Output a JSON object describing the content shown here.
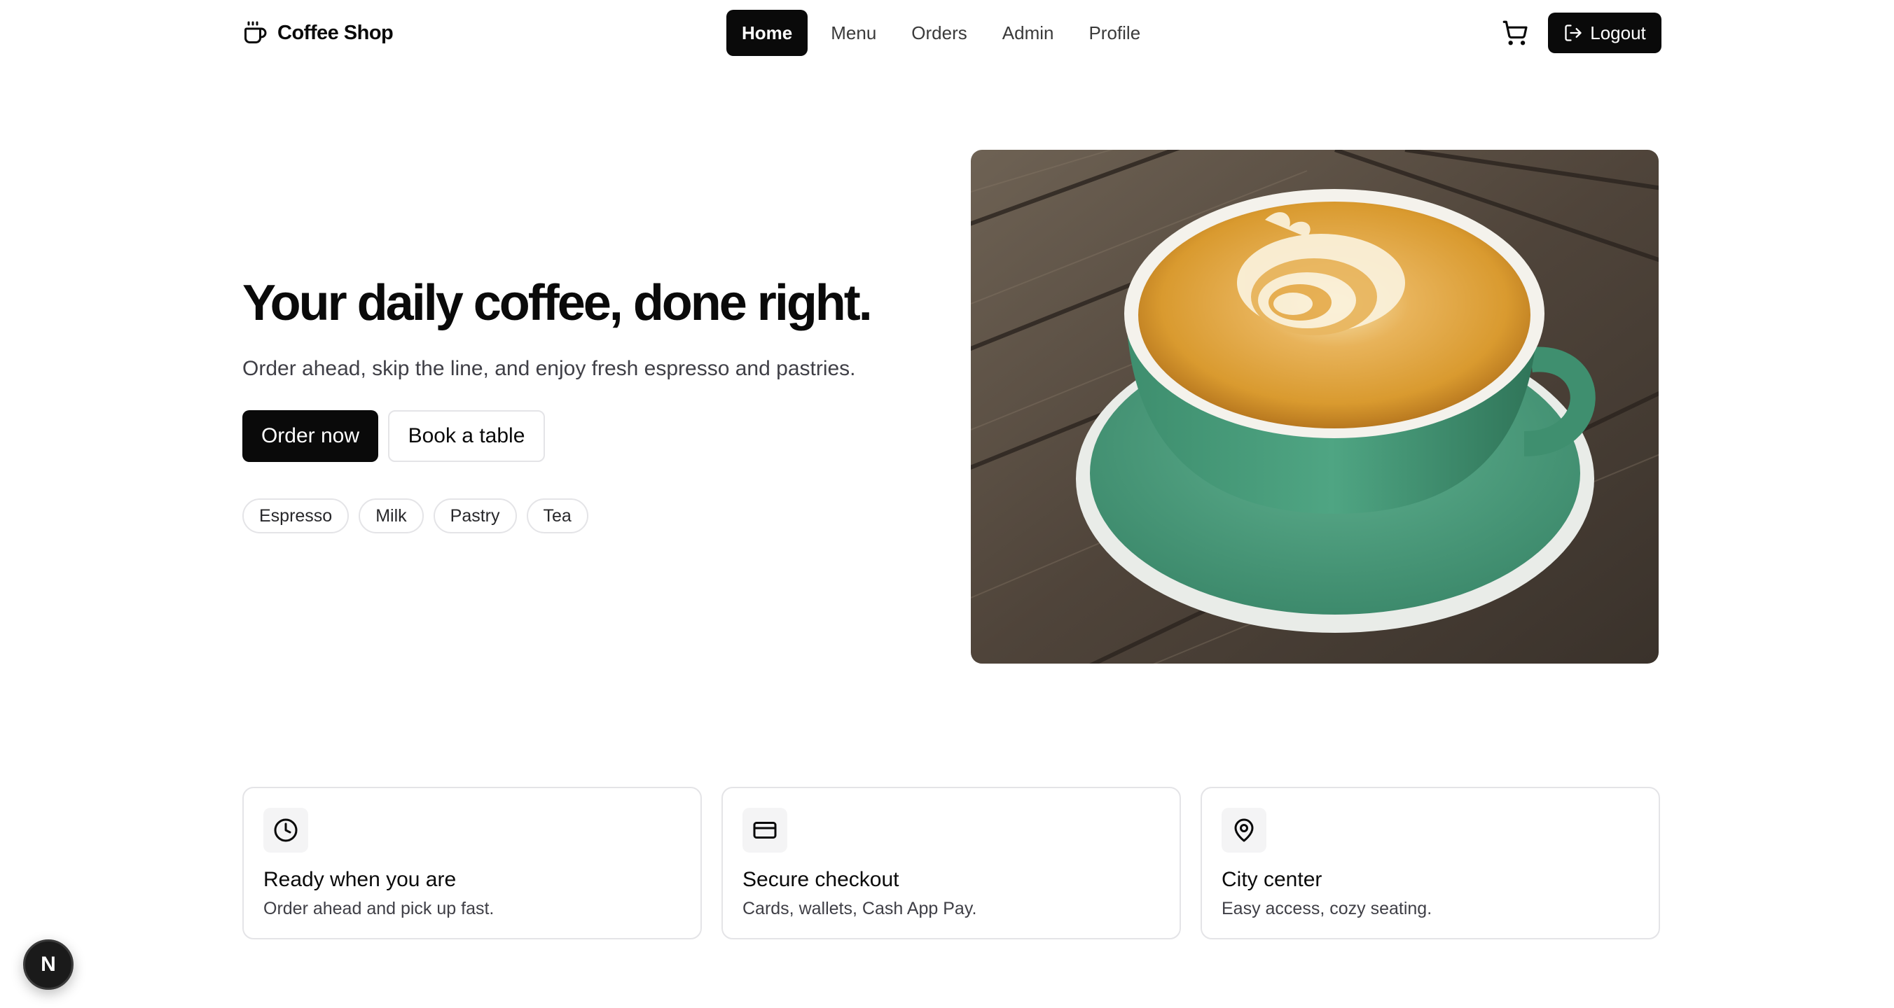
{
  "brand": {
    "name": "Coffee Shop",
    "icon": "coffee-cup-icon"
  },
  "nav": {
    "items": [
      {
        "label": "Home",
        "active": true
      },
      {
        "label": "Menu",
        "active": false
      },
      {
        "label": "Orders",
        "active": false
      },
      {
        "label": "Admin",
        "active": false
      },
      {
        "label": "Profile",
        "active": false
      }
    ]
  },
  "header_actions": {
    "cart_icon": "shopping-cart-icon",
    "logout_label": "Logout",
    "logout_icon": "logout-icon"
  },
  "hero": {
    "title": "Your daily coffee, done right.",
    "subtitle": "Order ahead, skip the line, and enjoy fresh espresso and pastries.",
    "primary_cta": "Order now",
    "secondary_cta": "Book a table",
    "tags": [
      "Espresso",
      "Milk",
      "Pastry",
      "Tea"
    ],
    "image": "latte-art-cup-photo"
  },
  "features": [
    {
      "icon": "clock-icon",
      "title": "Ready when you are",
      "description": "Order ahead and pick up fast."
    },
    {
      "icon": "credit-card-icon",
      "title": "Secure checkout",
      "description": "Cards, wallets, Cash App Pay."
    },
    {
      "icon": "map-pin-icon",
      "title": "City center",
      "description": "Easy access, cozy seating."
    }
  ],
  "dev_badge": {
    "label": "N"
  },
  "colors": {
    "primary": "#0a0a0a",
    "border": "#e4e4e7",
    "muted_text": "#3f3f46",
    "icon_bg": "#f4f4f5"
  }
}
